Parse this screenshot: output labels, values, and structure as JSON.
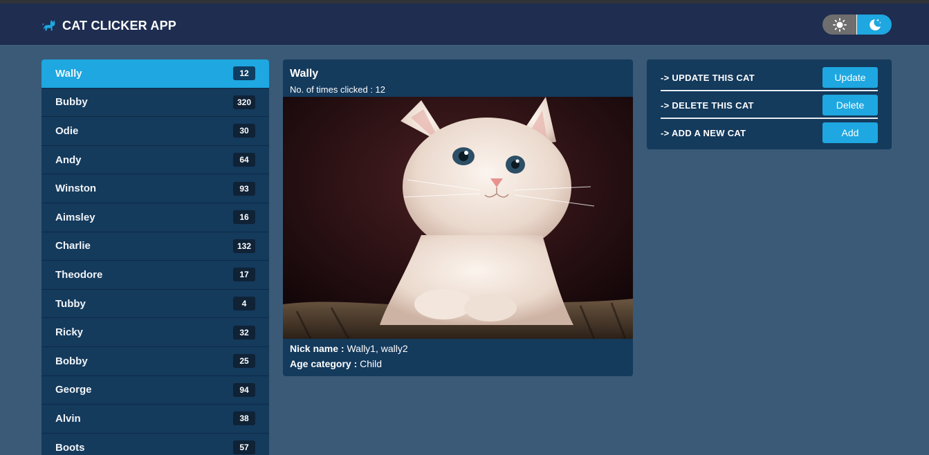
{
  "app": {
    "title": "CAT CLICKER APP"
  },
  "colors": {
    "accent": "#1ea7e0",
    "navbar": "#1e2d50",
    "panel": "#143a5c",
    "background": "#3a5a77"
  },
  "theme_toggle": {
    "light_icon": "sun-icon",
    "dark_icon": "moon-stars-icon",
    "selected": "dark"
  },
  "cats": [
    {
      "name": "Wally",
      "count": "12"
    },
    {
      "name": "Bubby",
      "count": "320"
    },
    {
      "name": "Odie",
      "count": "30"
    },
    {
      "name": "Andy",
      "count": "64"
    },
    {
      "name": "Winston",
      "count": "93"
    },
    {
      "name": "Aimsley",
      "count": "16"
    },
    {
      "name": "Charlie",
      "count": "132"
    },
    {
      "name": "Theodore",
      "count": "17"
    },
    {
      "name": "Tubby",
      "count": "4"
    },
    {
      "name": "Ricky",
      "count": "32"
    },
    {
      "name": "Bobby",
      "count": "25"
    },
    {
      "name": "George",
      "count": "94"
    },
    {
      "name": "Alvin",
      "count": "38"
    },
    {
      "name": "Boots",
      "count": "57"
    }
  ],
  "selected": {
    "name": "Wally",
    "clicks_label": "No. of times clicked : 12",
    "nickname_label": "Nick name :",
    "nickname_value": "Wally1, wally2",
    "age_label": "Age category :",
    "age_value": "Child"
  },
  "admin": {
    "update_label": "-> UPDATE THIS CAT",
    "update_button": "Update",
    "delete_label": "-> DELETE THIS CAT",
    "delete_button": "Delete",
    "add_label": "-> ADD A NEW CAT",
    "add_button": "Add"
  }
}
